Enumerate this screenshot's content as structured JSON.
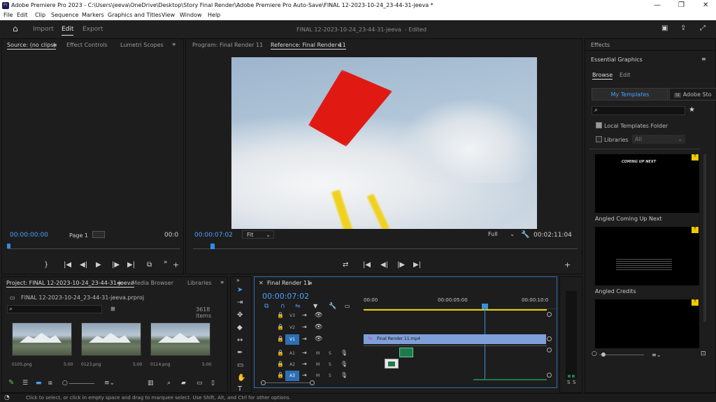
{
  "window": {
    "title": "Adobe Premiere Pro 2023 - C:\\Users\\jeeva\\OneDrive\\Desktop\\Story Final Render\\Adobe Premiere Pro Auto-Save\\FINAL 12-2023-10-24_23-44-31-jeeva *",
    "app_icon_text": "Pr"
  },
  "menu": [
    "File",
    "Edit",
    "Clip",
    "Sequence",
    "Markers",
    "Graphics and Titles",
    "View",
    "Window",
    "Help"
  ],
  "topbar": {
    "modes": [
      "Import",
      "Edit",
      "Export"
    ],
    "active_mode": "Edit",
    "project_title": "FINAL 12-2023-10-24_23-44-31-jeeva",
    "edited": "- Edited"
  },
  "source": {
    "tabs": [
      "Source: (no clips)",
      "Effect Controls",
      "Lumetri Scopes"
    ],
    "timecode": "00:00:00:00",
    "page": "Page 1",
    "end": "00:0"
  },
  "program": {
    "tabs": [
      "Program: Final Render 11",
      "Reference: Final Render 11"
    ],
    "timecode": "00:00:07:02",
    "fit": "Fit",
    "quality": "Full",
    "duration": "00:02:11:04"
  },
  "effects": {
    "tab": "Effects",
    "section": "Essential Graphics",
    "subtabs": [
      "Browse",
      "Edit"
    ],
    "toggle": [
      "My Templates",
      "Adobe Sto"
    ],
    "local_folder": "Local Templates Folder",
    "libraries": "Libraries",
    "libraries_value": "All",
    "templates": [
      {
        "name": "Angled Coming Up Next",
        "preview_text": "COMING UP NEXT"
      },
      {
        "name": "Angled Credits",
        "preview_text": ""
      },
      {
        "name": "",
        "preview_text": ""
      }
    ]
  },
  "project": {
    "tabs": [
      "Project: FINAL 12-2023-10-24_23-44-31-jeeva",
      "Media Browser",
      "Libraries"
    ],
    "file": "FINAL 12-2023-10-24_23-44-31-jeeva.prproj",
    "items_count": "3618 items",
    "clips": [
      {
        "name": "0105.png",
        "dur": "5:00"
      },
      {
        "name": "0123.png",
        "dur": "5:00"
      },
      {
        "name": "0114.png",
        "dur": "5:00"
      }
    ]
  },
  "timeline": {
    "tab": "Final Render 11",
    "timecode": "00:00:07:02",
    "ruler": [
      "00:00",
      "00:00:05:00",
      "00:00:10:0"
    ],
    "video_tracks": [
      "V3",
      "V2",
      "V1"
    ],
    "audio_tracks": [
      "A1",
      "A2",
      "A3"
    ],
    "clip": "Final Render 11.mp4",
    "fx": "fx",
    "audio_meter": [
      "S",
      "S"
    ]
  },
  "status": "Click to select, or click in empty space and drag to marquee select. Use Shift, Alt, and Ctrl for other options.",
  "colors": {
    "accent": "#2d8ceb",
    "clip": "#7f9fd8",
    "playhead": "#3a8fd8",
    "work_area": "#e3d400"
  }
}
